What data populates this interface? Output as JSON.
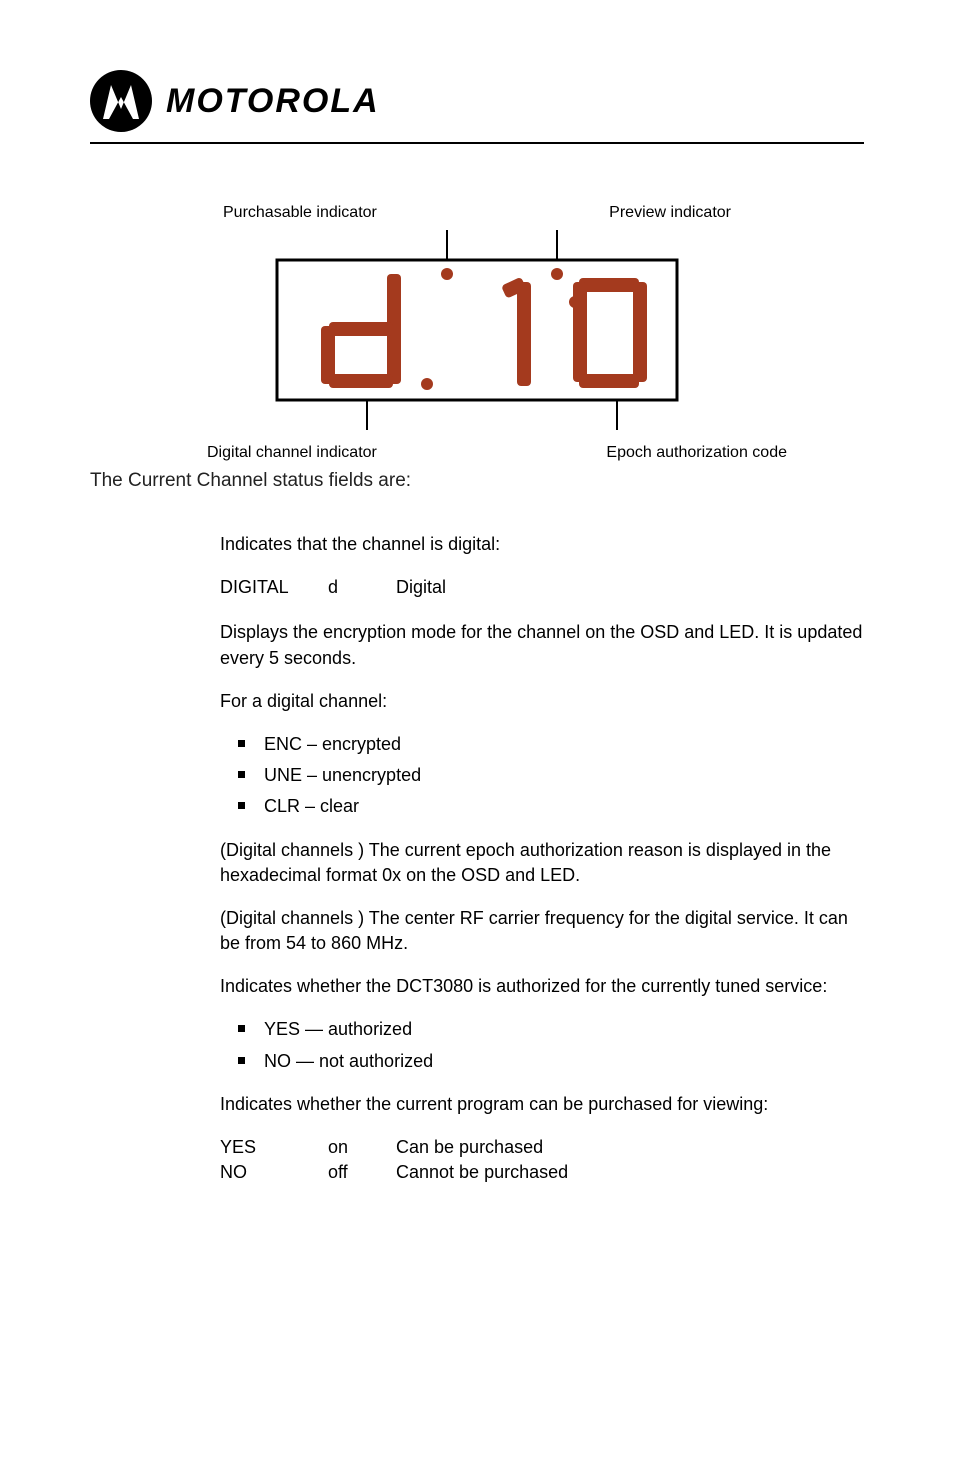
{
  "header": {
    "brand": "MOTOROLA"
  },
  "diagram": {
    "purchasable_label": "Purchasable indicator",
    "preview_label": "Preview indicator",
    "digital_channel_label": "Digital channel indicator",
    "epoch_label": "Epoch authorization code"
  },
  "intro": "The Current Channel status fields are:",
  "fields": {
    "digital_intro": "Indicates that the channel is digital:",
    "digital_table": {
      "osd": "DIGITAL",
      "led": "d",
      "desc": "Digital"
    },
    "encryption_osd_led": "Displays the encryption mode for the channel on the OSD and LED. It is updated every 5 seconds.",
    "for_digital": "For a digital channel:",
    "enc_item": "ENC – encrypted",
    "une_item": "UNE – unencrypted",
    "clr_item": "CLR – clear",
    "epoch_reason": "(Digital channels       ) The current epoch authorization reason is displayed in the hexadecimal format 0x     on the OSD and LED.",
    "rf_freq": "(Digital channels       ) The center RF carrier frequency for the digital service. It can be from 54 to 860 MHz.",
    "auth_intro": "Indicates whether the DCT3080 is authorized for the currently tuned service:",
    "auth_yes": "YES — authorized",
    "auth_no": "NO — not authorized",
    "purchase_intro": "Indicates whether the current program can be purchased for viewing:",
    "purchase_table": [
      {
        "osd": "YES",
        "led": "on",
        "desc": "Can be purchased"
      },
      {
        "osd": "NO",
        "led": "off",
        "desc": "Cannot be purchased"
      }
    ]
  }
}
